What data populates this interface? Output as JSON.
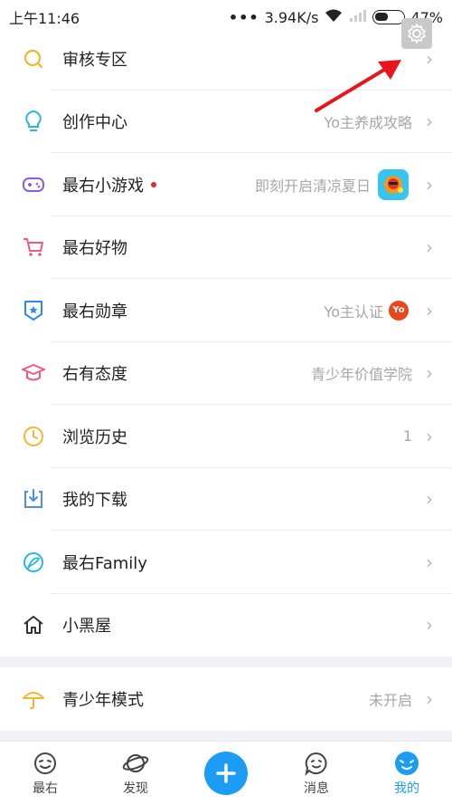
{
  "status_bar": {
    "time": "上午11:46",
    "dots": "•••",
    "network_speed": "3.94K/s",
    "battery_percent": "47%"
  },
  "menu": {
    "items": [
      {
        "label": "审核专区",
        "right_text": "",
        "icon": "search-icon"
      },
      {
        "label": "创作中心",
        "right_text": "Yo主养成攻略",
        "icon": "bulb-icon"
      },
      {
        "label": "最右小游戏",
        "right_text": "即刻开启清凉夏日",
        "icon": "gamepad-icon"
      },
      {
        "label": "最右好物",
        "right_text": "",
        "icon": "cart-icon"
      },
      {
        "label": "最右勋章",
        "right_text": "Yo主认证",
        "icon": "badge-icon"
      },
      {
        "label": "右有态度",
        "right_text": "青少年价值学院",
        "icon": "graduation-cap-icon"
      },
      {
        "label": "浏览历史",
        "right_text": "1",
        "icon": "clock-icon"
      },
      {
        "label": "我的下载",
        "right_text": "",
        "icon": "download-icon"
      },
      {
        "label": "最右Family",
        "right_text": "",
        "icon": "family-icon"
      },
      {
        "label": "小黑屋",
        "right_text": "",
        "icon": "house-icon"
      }
    ],
    "youth_mode": {
      "label": "青少年模式",
      "right_text": "未开启",
      "icon": "umbrella-icon"
    },
    "yo_badge_text": "Yo"
  },
  "tab_bar": {
    "tabs": [
      {
        "label": "最右",
        "icon": "face-icon"
      },
      {
        "label": "发现",
        "icon": "planet-icon"
      },
      {
        "label": "",
        "icon": "plus-icon"
      },
      {
        "label": "消息",
        "icon": "message-icon"
      },
      {
        "label": "我的",
        "icon": "profile-icon"
      }
    ],
    "active": "我的"
  },
  "colors": {
    "accent": "#1b9cf5",
    "red_dot": "#e6262e",
    "arrow": "#e8161b"
  }
}
